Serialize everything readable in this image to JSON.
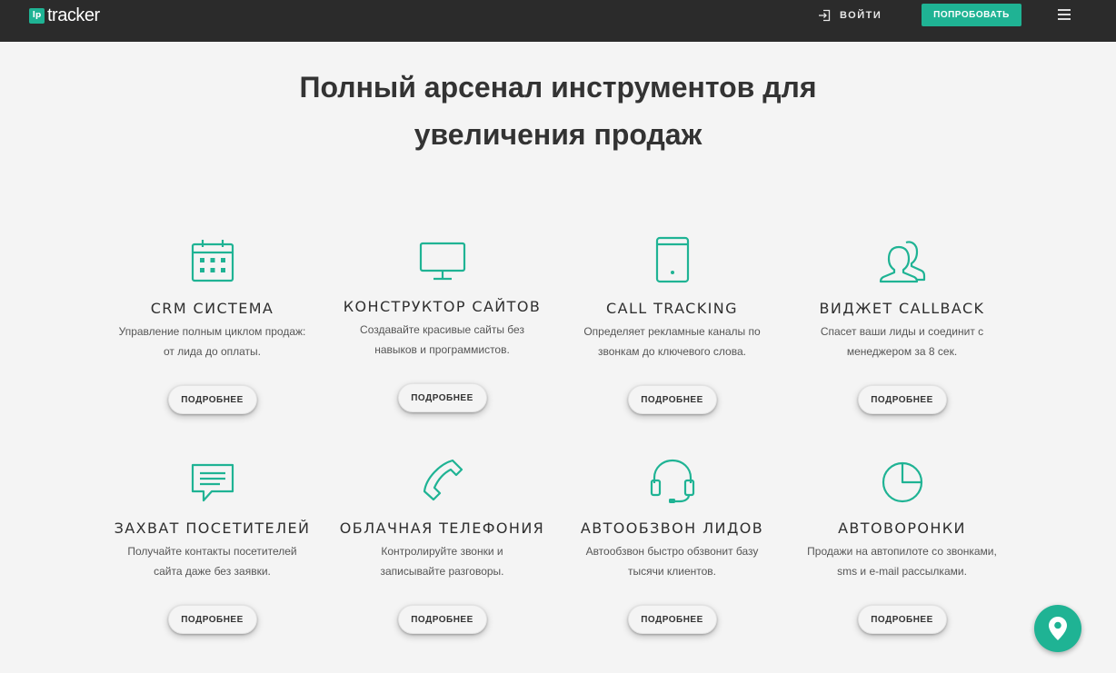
{
  "header": {
    "logo_mark": "lp",
    "logo_text": "tracker",
    "login_label": "ВОЙТИ",
    "try_label": "ПОПРОБОВАТЬ"
  },
  "headline": {
    "line1": "Полный арсенал инструментов для",
    "line2": "увеличения продаж"
  },
  "more_label": "ПОДРОБНЕЕ",
  "features": [
    {
      "icon": "calendar-icon",
      "title": "CRM СИСТЕМА",
      "desc1": "Управление полным циклом продаж:",
      "desc2": "от лида до оплаты."
    },
    {
      "icon": "monitor-icon",
      "title": "КОНСТРУКТОР САЙТОВ",
      "desc1": "Создавайте красивые сайты без",
      "desc2": "навыков и программистов."
    },
    {
      "icon": "tablet-icon",
      "title": "CALL TRACKING",
      "desc1": "Определяет рекламные каналы по",
      "desc2": "звонкам до ключевого слова."
    },
    {
      "icon": "users-icon",
      "title": "ВИДЖЕТ CALLBACK",
      "desc1": "Спасет ваши лиды и соединит с",
      "desc2": "менеджером за 8 сек."
    },
    {
      "icon": "chat-icon",
      "title": "ЗАХВАТ ПОСЕТИТЕЛЕЙ",
      "desc1": "Получайте контакты посетителей",
      "desc2": "сайта даже без заявки."
    },
    {
      "icon": "phone-icon",
      "title": "ОБЛАЧНАЯ ТЕЛЕФОНИЯ",
      "desc1": "Контролируйте звонки и",
      "desc2": "записывайте разговоры."
    },
    {
      "icon": "headset-icon",
      "title": "АВТООБЗВОН ЛИДОВ",
      "desc1": "Автообзвон быстро обзвонит базу",
      "desc2": "тысячи клиентов."
    },
    {
      "icon": "pie-chart-icon",
      "title": "АВТОВОРОНКИ",
      "desc1": "Продажи на автопилоте со звонками,",
      "desc2": "sms и e-mail рассылками."
    }
  ],
  "colors": {
    "accent": "#1fb394",
    "topbar": "#2b2b2b",
    "background": "#f4f4f4"
  }
}
